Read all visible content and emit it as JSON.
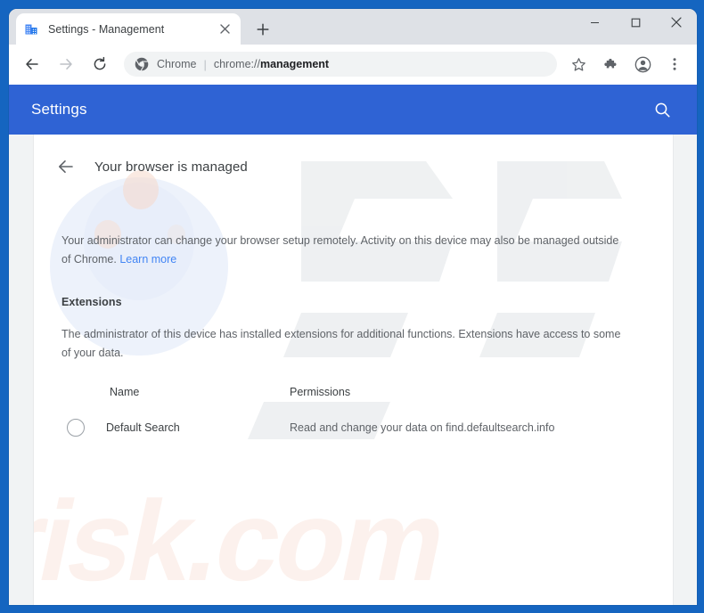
{
  "window": {
    "controls": {
      "minimize": "minimize-icon",
      "maximize": "maximize-icon",
      "close": "close-icon"
    }
  },
  "tabstrip": {
    "tabs": [
      {
        "title": "Settings - Management",
        "favicon": "managed-browser-icon",
        "close": "tab-close-icon",
        "active": true
      }
    ],
    "new_tab_label": "+"
  },
  "toolbar": {
    "back": "back-arrow-icon",
    "forward": "forward-arrow-icon",
    "reload": "reload-icon",
    "omnibox": {
      "icon": "chrome-logo-icon",
      "scheme_label": "Chrome",
      "separator": "|",
      "url_prefix": "chrome://",
      "url_bold": "management",
      "url_full": "chrome://management"
    },
    "bookmark": "star-icon",
    "extensions": "puzzle-piece-icon",
    "profile": "account-avatar-icon",
    "menu": "three-dot-menu-icon"
  },
  "settings_header": {
    "title": "Settings",
    "search_icon": "search-icon"
  },
  "page": {
    "back_icon": "back-arrow-icon",
    "title": "Your browser is managed",
    "intro_text": "Your administrator can change your browser setup remotely. Activity on this device may also be managed outside of Chrome. ",
    "intro_link": "Learn more",
    "section_title": "Extensions",
    "section_text": "The administrator of this device has installed extensions for additional functions. Extensions have access to some of your data.",
    "table": {
      "headers": {
        "name": "Name",
        "permissions": "Permissions"
      },
      "rows": [
        {
          "icon": "extension-placeholder-icon",
          "name": "Default Search",
          "permissions": "Read and change your data on find.defaultsearch.info"
        }
      ]
    }
  },
  "colors": {
    "window_frame": "#1565c0",
    "tabstrip_bg": "#dee1e6",
    "settings_header_blue": "#2f63d4",
    "link_blue": "#4285f4",
    "page_bg": "#f1f3f4",
    "text_primary": "#3c4043",
    "text_secondary": "#5f6368"
  },
  "watermark": {
    "text": "risk.com",
    "logo": "pcrisk-logo-watermark"
  }
}
